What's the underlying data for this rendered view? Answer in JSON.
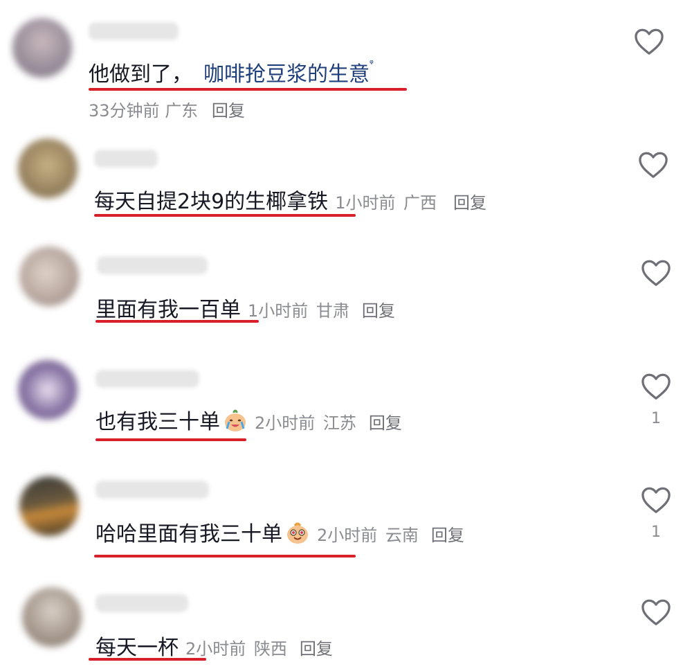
{
  "comments": [
    {
      "text": "他做到了，",
      "link": "咖啡抢豆浆的生意",
      "search_mark": "ᵠ",
      "time": "33分钟前",
      "location": "广东",
      "reply": "回复",
      "avatar_color": "#9a8f9b",
      "heart_icon": "heart-outline-icon"
    },
    {
      "text": "每天自提2块9的生椰拿铁",
      "time": "1小时前",
      "location": "广西",
      "reply": "回复",
      "avatar_color": "#9b8662"
    },
    {
      "text": "里面有我一百单",
      "time": "1小时前",
      "location": "甘肃",
      "reply": "回复",
      "avatar_color": "#b8a8a0"
    },
    {
      "text": "也有我三十单",
      "emoji": "crying-laugh-emoji",
      "time": "2小时前",
      "location": "江苏",
      "reply": "回复",
      "likes": "1",
      "avatar_color": "#8e7aa8"
    },
    {
      "text": "哈哈里面有我三十单",
      "emoji": "starry-eyes-emoji",
      "time": "2小时前",
      "location": "云南",
      "reply": "回复",
      "likes": "1",
      "avatar_color": "#6b5a3e"
    },
    {
      "text": "每天一杯",
      "time": "2小时前",
      "location": "陕西",
      "reply": "回复",
      "avatar_color": "#a79a8f"
    }
  ],
  "colors": {
    "underline": "#d8202a",
    "text": "#161823",
    "meta": "#8a8b91",
    "link": "#1f3f7a"
  }
}
